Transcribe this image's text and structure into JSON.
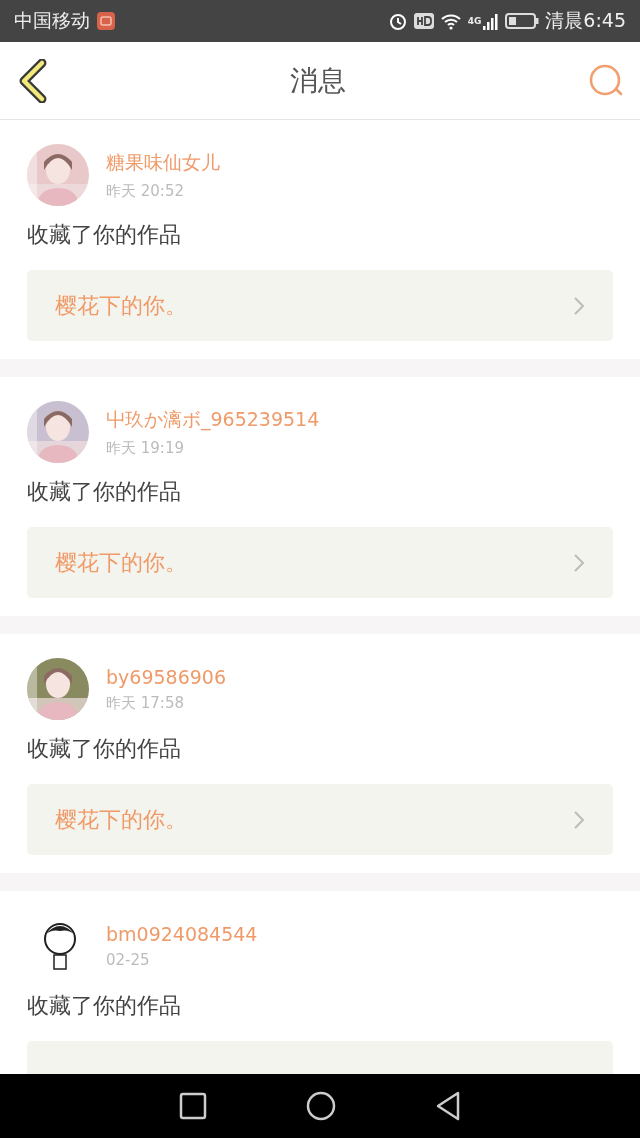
{
  "status_bar": {
    "carrier": "中国移动",
    "network": "4G",
    "time": "清晨6:45"
  },
  "header": {
    "title": "消息"
  },
  "messages": [
    {
      "name": "糖果味仙女儿",
      "time": "昨天 20:52",
      "action": "收藏了你的作品",
      "work_title": "樱花下的你。"
    },
    {
      "name": "屮玖か漓ボ_965239514",
      "time": "昨天 19:19",
      "action": "收藏了你的作品",
      "work_title": "樱花下的你。"
    },
    {
      "name": "by69586906",
      "time": "昨天 17:58",
      "action": "收藏了你的作品",
      "work_title": "樱花下的你。"
    },
    {
      "avatar": {
        "kind": "cartoon"
      },
      "name": "bm0924084544",
      "time": "02-25",
      "action": "收藏了你的作品"
    }
  ]
}
